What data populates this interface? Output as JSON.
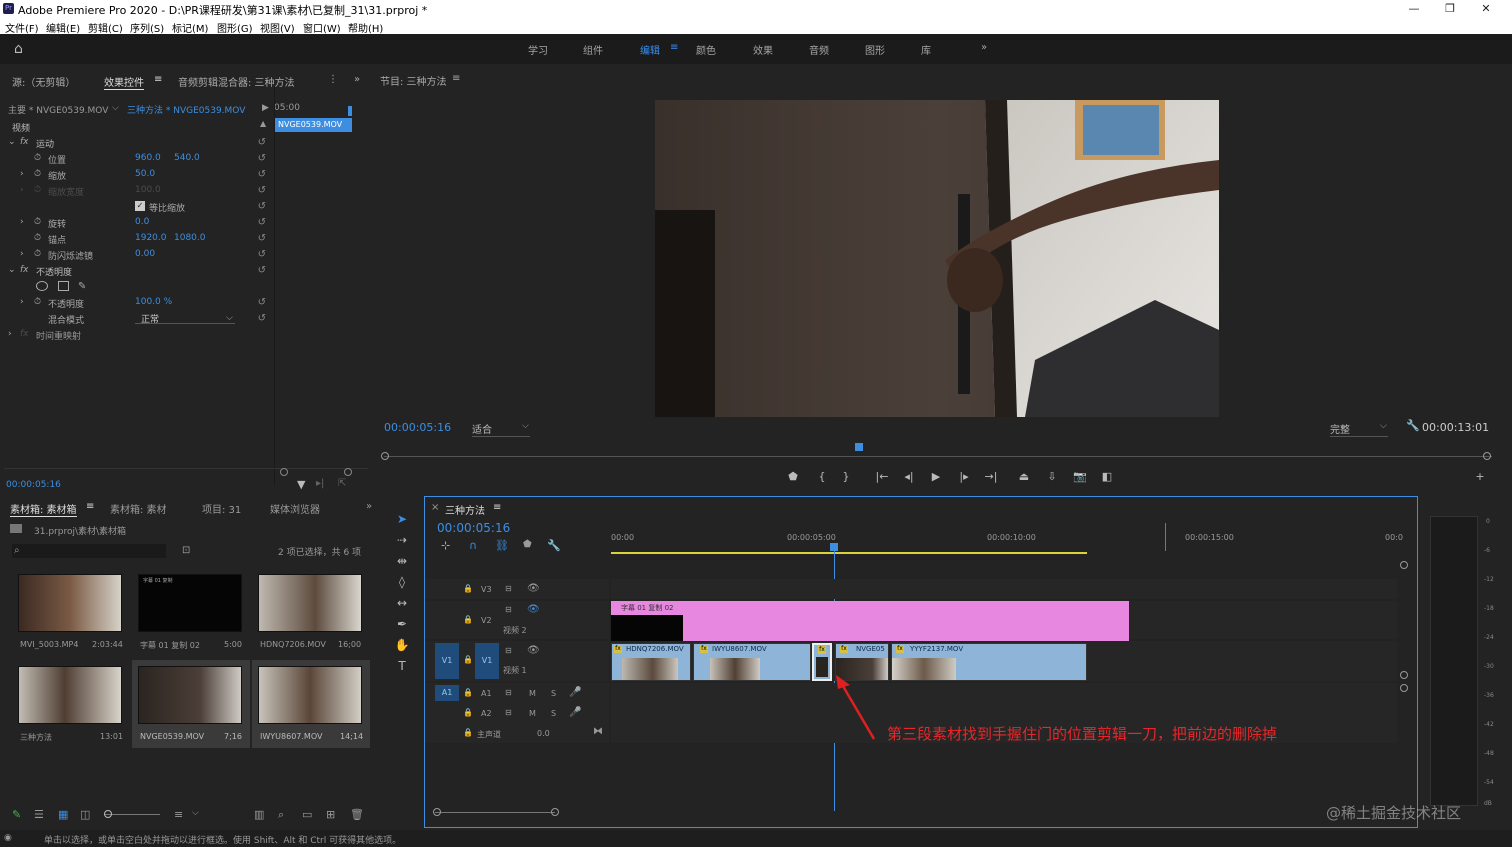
{
  "window": {
    "title": "Adobe Premiere Pro 2020 - D:\\PR课程研发\\第31课\\素材\\已复制_31\\31.prproj *",
    "logo": "Pr",
    "min": "—",
    "max": "❐",
    "close": "✕"
  },
  "menu": [
    "文件(F)",
    "编辑(E)",
    "剪辑(C)",
    "序列(S)",
    "标记(M)",
    "图形(G)",
    "视图(V)",
    "窗口(W)",
    "帮助(H)"
  ],
  "workspaces": {
    "items": [
      "学习",
      "组件",
      "编辑",
      "颜色",
      "效果",
      "音频",
      "图形",
      "库"
    ],
    "active": "编辑",
    "more": "»"
  },
  "effect_panel": {
    "tabs": [
      "源:（无剪辑）",
      "效果控件",
      "音频剪辑混合器: 三种方法"
    ],
    "master": "主要 * NVGE0539.MOV",
    "seq": "三种方法 * NVGE0539.MOV",
    "time_head": "05:00",
    "clip_label": "NVGE0539.MOV",
    "video_label": "视频",
    "rows": [
      {
        "name": "运动",
        "fx": true
      },
      {
        "name": "位置",
        "v1": "960.0",
        "v2": "540.0"
      },
      {
        "name": "缩放",
        "v1": "50.0"
      },
      {
        "name": "缩放宽度",
        "v1": "100.0",
        "disabled": true
      },
      {
        "name": "等比缩放",
        "checkbox": true
      },
      {
        "name": "旋转",
        "v1": "0.0"
      },
      {
        "name": "锚点",
        "v1": "1920.0",
        "v2": "1080.0"
      },
      {
        "name": "防闪烁滤镜",
        "v1": "0.00"
      },
      {
        "name": "不透明度",
        "fx": true
      },
      {
        "name": "",
        "shapes": true
      },
      {
        "name": "不透明度",
        "v1": "100.0 %"
      },
      {
        "name": "混合模式",
        "select": "正常"
      },
      {
        "name": "时间重映射",
        "fx": true,
        "disabled": true
      }
    ],
    "timecode": "00:00:05:16"
  },
  "program": {
    "title": "节目: 三种方法",
    "timecode": "00:00:05:16",
    "fit": "适合",
    "quality": "完整",
    "duration": "00:00:13:01"
  },
  "project": {
    "tabs": [
      "素材箱: 素材箱",
      "素材箱: 素材",
      "项目: 31",
      "媒体浏览器"
    ],
    "path": "31.prproj\\素材\\素材箱",
    "selection": "2 项已选择，共 6 项",
    "items": [
      {
        "name": "MVI_5003.MP4",
        "dur": "2:03:44"
      },
      {
        "name": "字幕 01 复制 02",
        "dur": "5:00"
      },
      {
        "name": "HDNQ7206.MOV",
        "dur": "16;00"
      },
      {
        "name": "三种方法",
        "dur": "13:01"
      },
      {
        "name": "NVGE0539.MOV",
        "dur": "7;16"
      },
      {
        "name": "IWYU8607.MOV",
        "dur": "14;14"
      }
    ],
    "title_thumb": "字幕 01 复制"
  },
  "timeline": {
    "title": "三种方法",
    "timecode": "00:00:05:16",
    "ruler": [
      "00:00",
      "00:00:05:00",
      "00:00:10:00",
      "00:00:15:00",
      "00:0"
    ],
    "tracks": {
      "v3": "V3",
      "v2": "V2",
      "v2name": "视频 2",
      "v1": "V1",
      "v1name": "视频 1",
      "a1": "A1",
      "a2": "A2",
      "master": "主声道",
      "master_val": "0.0"
    },
    "title_clip": "字幕 01 复制 02",
    "clips": [
      "HDNQ7206.MOV",
      "IWYU8607.MOV",
      "fx",
      "NVGE05",
      "YYYF2137.MOV"
    ],
    "annotation": "第三段素材找到手握住门的位置剪辑一刀，把前边的删除掉"
  },
  "meter": {
    "scale": [
      "0",
      "-6",
      "-12",
      "-18",
      "-24",
      "-30",
      "-36",
      "-42",
      "-48",
      "-54",
      "dB"
    ]
  },
  "status": "单击以选择，或单击空白处并拖动以进行框选。使用 Shift、Alt 和 Ctrl 可获得其他选项。",
  "watermark": "@稀土掘金技术社区"
}
